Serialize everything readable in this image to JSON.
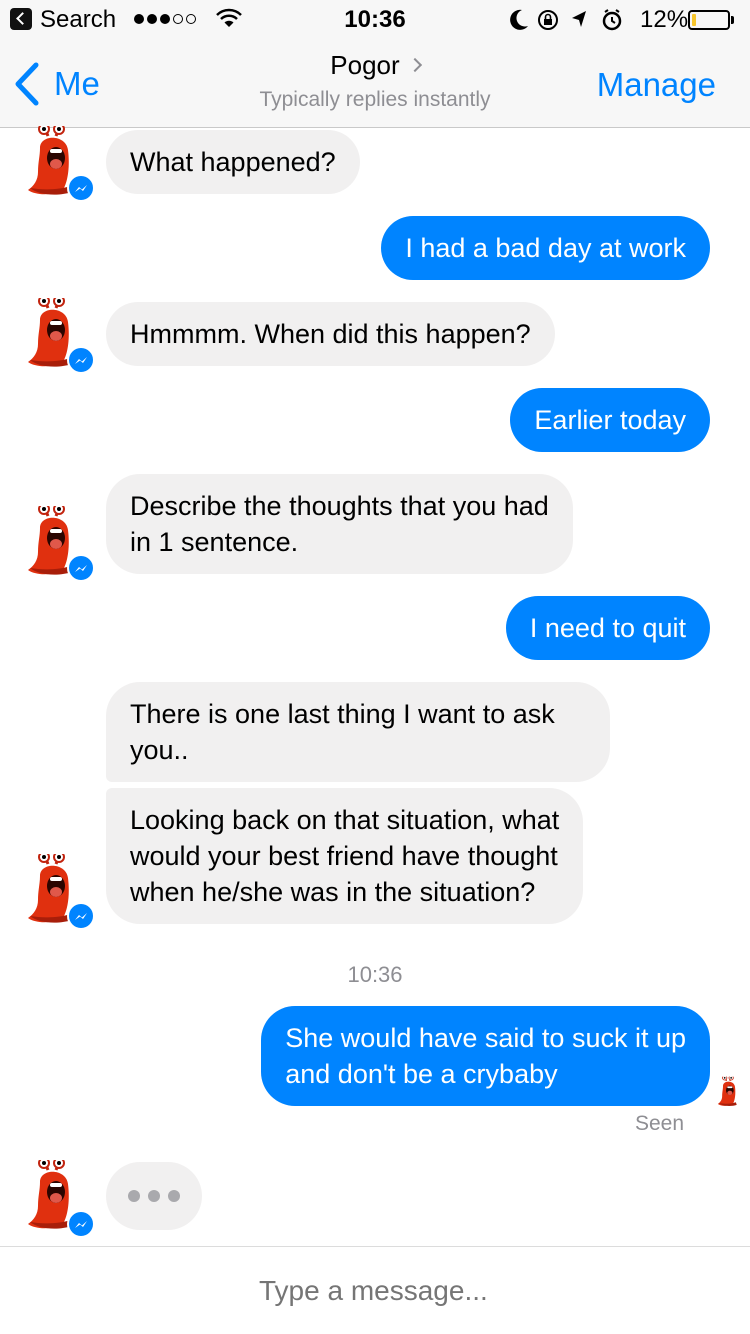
{
  "status_bar": {
    "back_app": "Search",
    "time": "10:36",
    "battery_percent": "12%",
    "battery_level": 0.12,
    "signal_bars": 3,
    "signal_max": 5
  },
  "header": {
    "back_label": "Me",
    "title": "Pogor",
    "subtitle": "Typically replies instantly",
    "manage_label": "Manage"
  },
  "colors": {
    "accent": "#0084ff",
    "incoming_bubble": "#f1f0f0",
    "outgoing_bubble": "#0084ff"
  },
  "messages": [
    {
      "from": "bot",
      "text": "What happened?"
    },
    {
      "from": "me",
      "text": "I had a bad day at work"
    },
    {
      "from": "bot",
      "text": "Hmmmm. When did this happen?"
    },
    {
      "from": "me",
      "text": "Earlier today"
    },
    {
      "from": "bot",
      "line1": "Describe the thoughts that you had",
      "line2": "in 1 sentence."
    },
    {
      "from": "me",
      "text": "I need to quit"
    },
    {
      "from": "bot",
      "line1": "There is one last thing I want to ask",
      "line2": "you.."
    },
    {
      "from": "bot",
      "line1": "Looking back on that situation, what",
      "line2": "would your best friend have thought",
      "line3": "when he/she was in the situation?"
    },
    {
      "from": "me",
      "line1": "She would have said to suck it up",
      "line2": "and don't be a crybaby"
    }
  ],
  "timestamp": "10:36",
  "seen_label": "Seen",
  "composer": {
    "placeholder": "Type a message..."
  },
  "icons": {
    "avatar": "red-slug-avatar-icon",
    "badge": "messenger-badge-icon"
  }
}
